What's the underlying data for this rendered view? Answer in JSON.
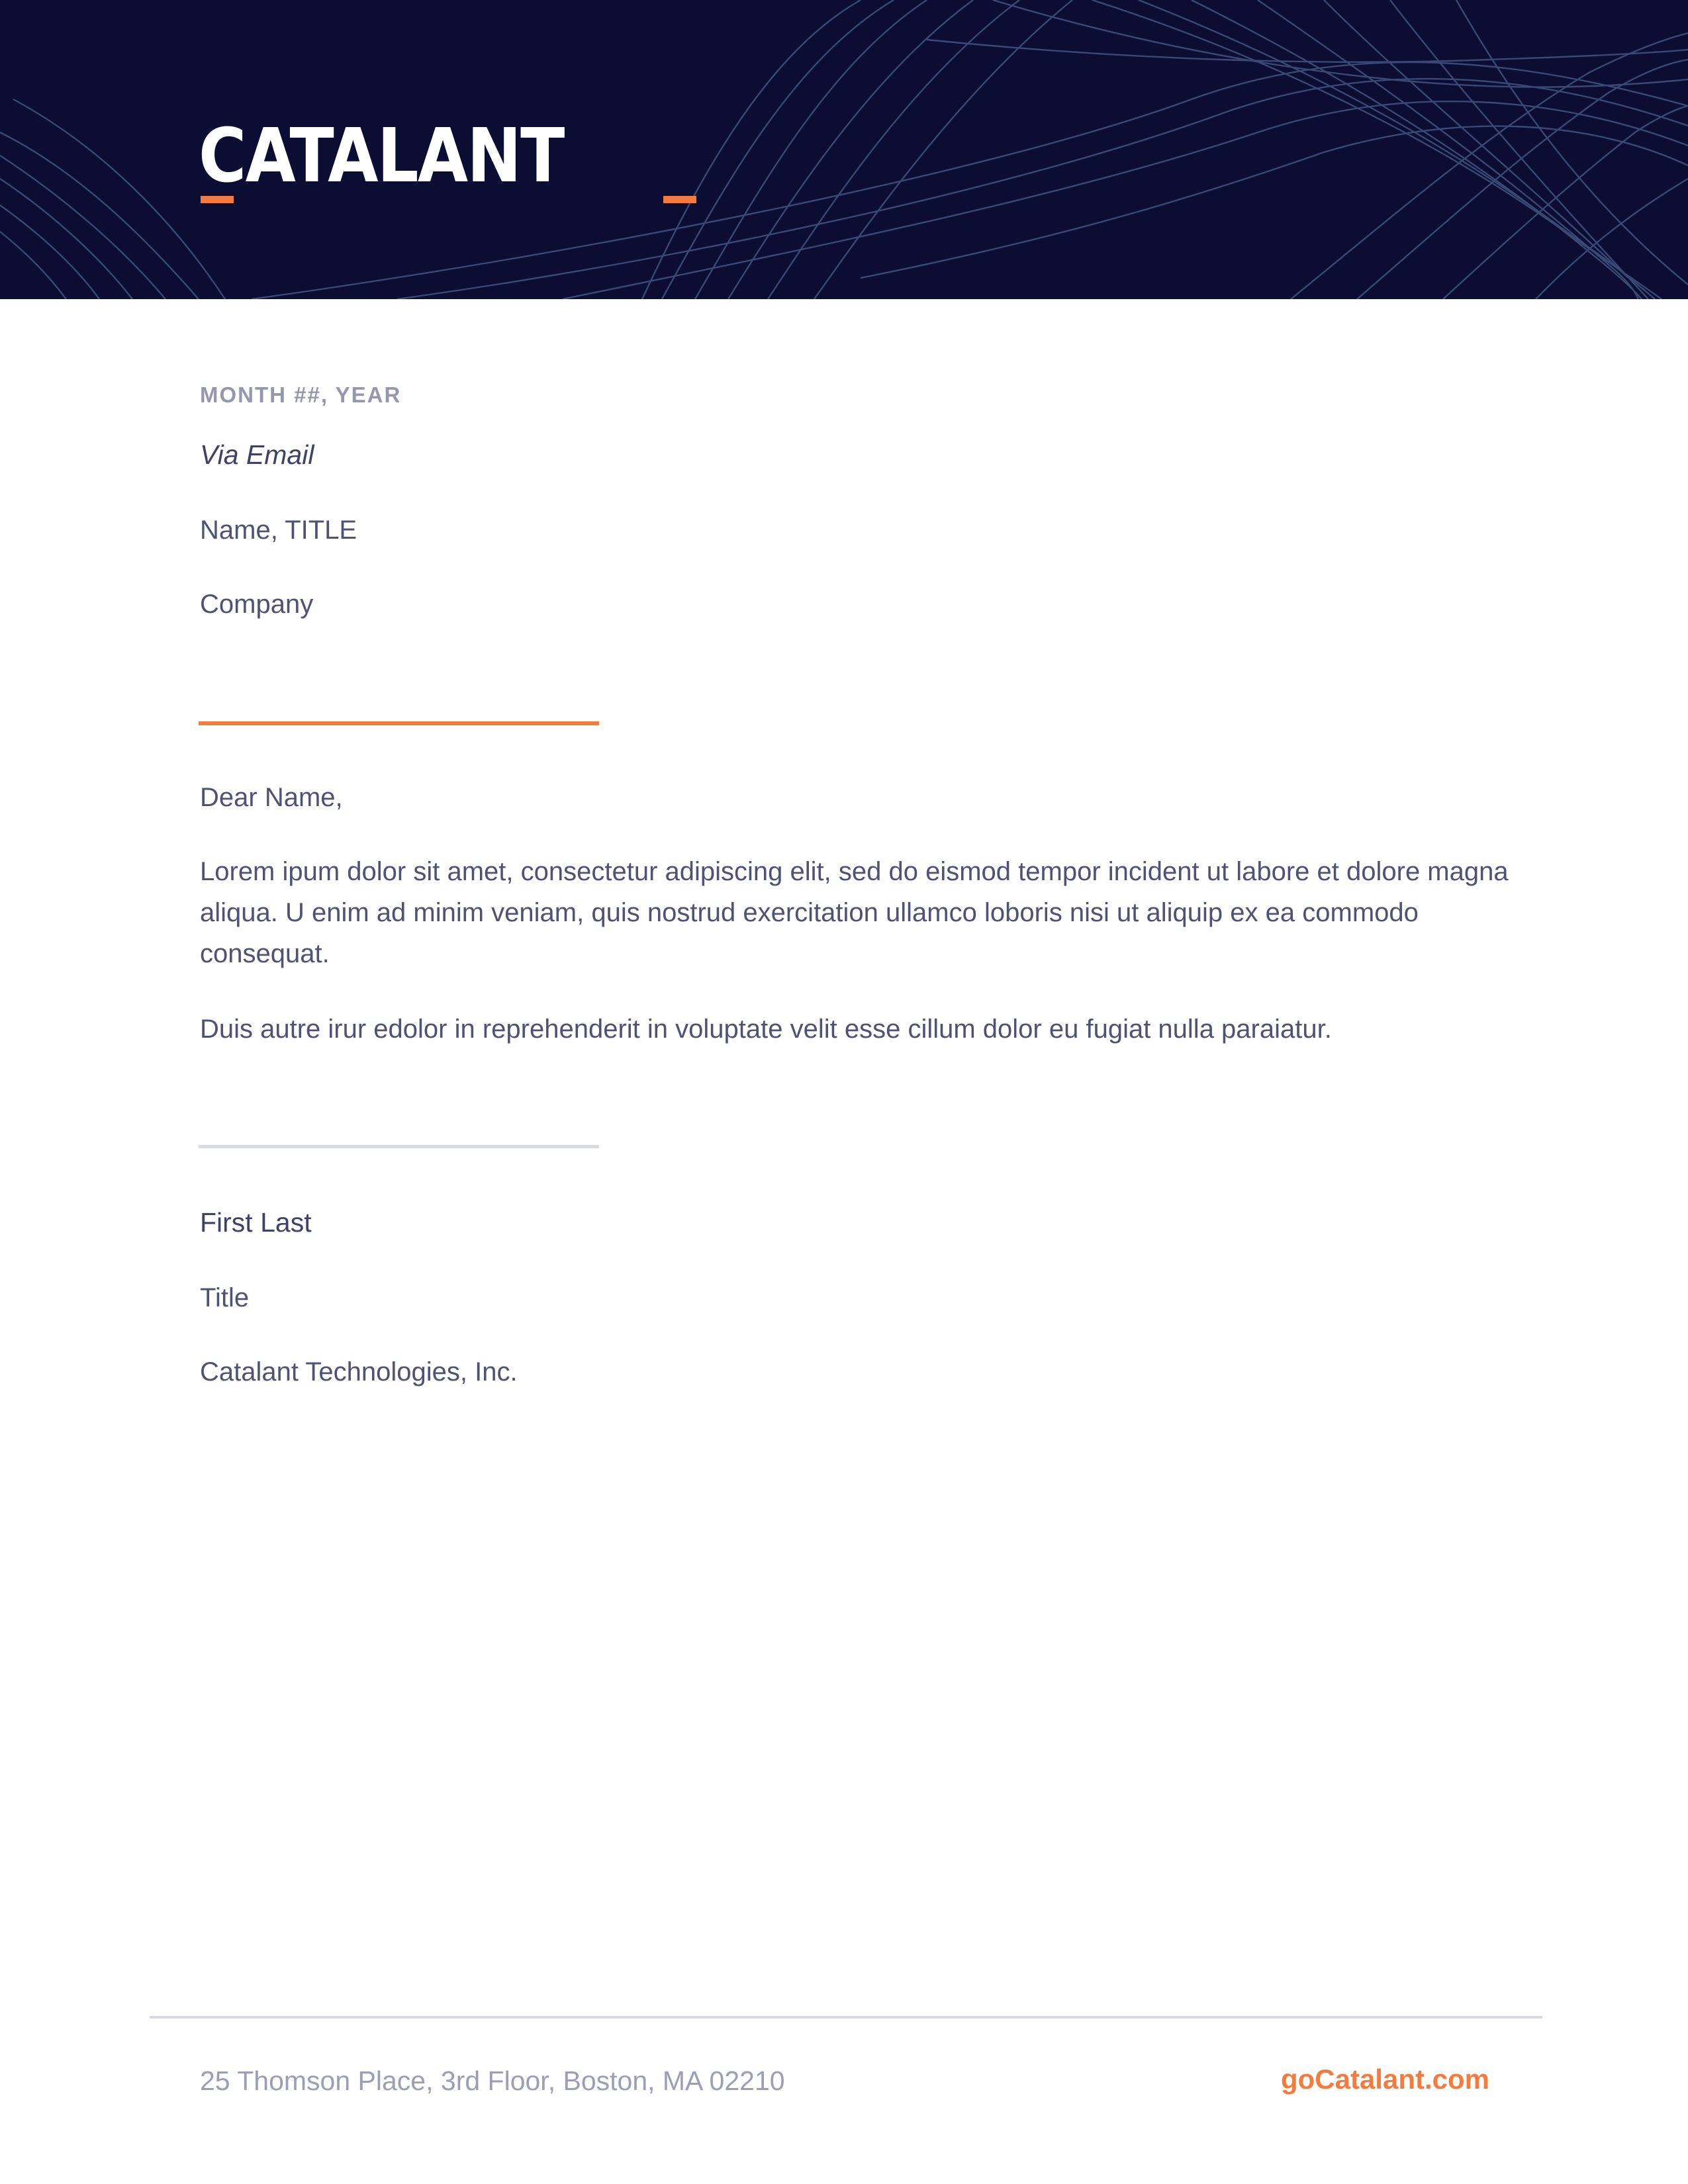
{
  "header": {
    "logo_text": "CATALANT",
    "background_color": "#0c0d33",
    "accent_color": "#f47b3e"
  },
  "letter": {
    "date": "MONTH ##, YEAR",
    "delivery": "Via Email",
    "recipient_name": "Name, TITLE",
    "recipient_company": "Company",
    "salutation": "Dear Name,",
    "paragraphs": [
      "Lorem ipum dolor sit amet, consectetur adipiscing elit, sed do eismod tempor incident ut labore et dolore magna aliqua. U enim ad minim veniam, quis nostrud exercitation ullamco loboris nisi ut aliquip ex ea commodo consequat.",
      "Duis autre irur edolor in reprehenderit in voluptate velit esse cillum dolor eu fugiat nulla paraiatur."
    ],
    "signature": {
      "name": "First Last",
      "title": "Title",
      "company": "Catalant Technologies, Inc."
    }
  },
  "footer": {
    "address": "25 Thomson Place, 3rd Floor, Boston, MA 02210",
    "website": "goCatalant.com"
  }
}
